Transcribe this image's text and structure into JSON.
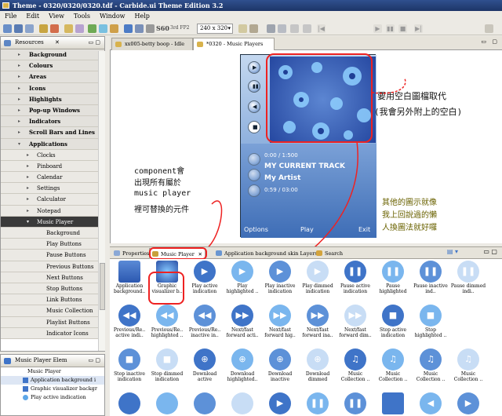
{
  "app": {
    "title": "Theme - 0320/0320/0320.tdf - Carbide.ui Theme Edition 3.2"
  },
  "menu": [
    "File",
    "Edit",
    "View",
    "Tools",
    "Window",
    "Help"
  ],
  "toolbar": {
    "resolution_label": "S60",
    "resolution_sub": "3rd FP2",
    "screen_size": "240 x 320"
  },
  "resources": {
    "tab_label": "Resources",
    "categories": [
      "Background",
      "Colours",
      "Areas",
      "Icons",
      "Highlights",
      "Pop-up Windows",
      "Indicators",
      "Scroll Bars and Lines",
      "Applications"
    ],
    "applications": [
      "Clocks",
      "Pinboard",
      "Calendar",
      "Settings",
      "Calculator",
      "Notepad",
      "Music Player"
    ],
    "music_player_items": [
      "Background",
      "Play Buttons",
      "Pause Buttons",
      "Previous Buttons",
      "Next Buttons",
      "Stop Buttons",
      "Link Buttons",
      "Music Collection Butt",
      "Playlist Buttons",
      "Indicator Icons"
    ]
  },
  "elements_view": {
    "tab_label": "Music Player Elem",
    "root": "Music Player",
    "items": [
      "Application background i",
      "Graphic visualizer backgr",
      "Play active indication"
    ]
  },
  "editor_tabs": [
    "xx005-betty boop - Idle",
    "*0320 - Music Players"
  ],
  "phone": {
    "time": "0:00 / 1:500",
    "track": "MY CURRENT TRACK",
    "artist": "My Artist",
    "elapsed": "0:59 / 03:00",
    "soft_left": "Options",
    "soft_center": "Play",
    "soft_right": "Exit"
  },
  "annotations": {
    "top_right": "要用空白圖檔取代",
    "top_right2": "(我會另外附上的空白)",
    "left1": "component會",
    "left2": "出現所有屬於",
    "left3": "music player",
    "left4": "裡可替換的元件",
    "right1": "其他的圖示就像",
    "right2": "我上回說過的懶",
    "right3": "人換圖法就好囉"
  },
  "view_tabs": [
    "Properties",
    "Music Player",
    "Application background skin Layers",
    "Search"
  ],
  "gallery": {
    "rows": [
      [
        "Application background..",
        "Graphic visualizer b..",
        "Play active indication",
        "Play highlighted ..",
        "Play inactive indication",
        "Play dimmed indication",
        "Pause active indication",
        "Pause highlighted in..",
        "Pause inactive ind..",
        "Pause dimmed indi.."
      ],
      [
        "Previous/Re.. active indi..",
        "Previous/Re.. highlighted ..",
        "Previous/Re.. inactive in..",
        "Next/fast forward acti..",
        "Next/fast forward hig..",
        "Next/fast forward ina..",
        "Next/fast forward dim..",
        "Stop active indication",
        "Stop highlighted ..",
        ""
      ],
      [
        "Stop inactive indication",
        "Stop dimmed indication",
        "Download active indication",
        "Download highlighted..",
        "Download inactive indication",
        "Download dimmed indication",
        "Music Collection ..",
        "Music Collection ..",
        "Music Collection ..",
        "Music Collection .."
      ]
    ]
  },
  "colors": {
    "accent": "#3f74c8",
    "red": "#e52222",
    "title": "#1d3567"
  }
}
